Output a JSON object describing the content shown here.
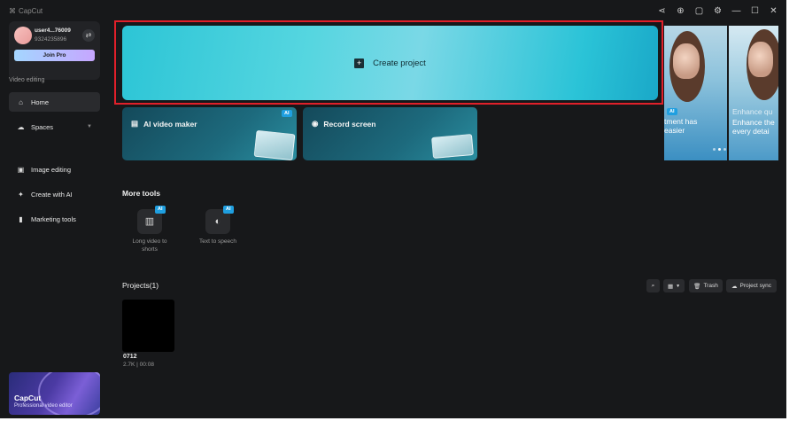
{
  "app": {
    "name": "CapCut"
  },
  "user": {
    "name": "user4...76009",
    "id": "9324235896",
    "join_pro": "Join Pro"
  },
  "sidebar": {
    "section_label": "Video editing",
    "items": [
      {
        "label": "Home",
        "icon": "home-icon",
        "active": true
      },
      {
        "label": "Spaces",
        "icon": "cloud-icon"
      },
      {
        "label": "Image editing",
        "icon": "image-icon"
      },
      {
        "label": "Create with AI",
        "icon": "sparkle-icon"
      },
      {
        "label": "Marketing tools",
        "icon": "marketing-icon"
      }
    ],
    "promo": {
      "title": "CapCut",
      "subtitle": "Professional video editor"
    }
  },
  "main": {
    "create_project": "Create project",
    "cards": [
      {
        "label": "AI video maker",
        "badge": "AI"
      },
      {
        "label": "Record screen"
      }
    ],
    "banner": {
      "slide1": {
        "badge": "AI",
        "text_line1": "tment has",
        "text_line2": "easier"
      },
      "slide2": {
        "text_line1": "Enhance qu",
        "text_line2": "Enhance the",
        "text_line3": "every detai"
      }
    },
    "more_tools": {
      "title": "More tools",
      "items": [
        {
          "label_line1": "Long video to",
          "label_line2": "shorts",
          "badge": "AI"
        },
        {
          "label_line1": "Text to speech",
          "label_line2": "",
          "badge": "AI"
        }
      ]
    },
    "projects": {
      "title": "Projects(1)",
      "trash": "Trash",
      "sync": "Project sync",
      "items": [
        {
          "name": "0712",
          "meta": "2.7K | 00:08"
        }
      ]
    }
  },
  "colors": {
    "accent": "#2cc5d6",
    "highlight": "#e0202a",
    "background": "#17181a"
  }
}
